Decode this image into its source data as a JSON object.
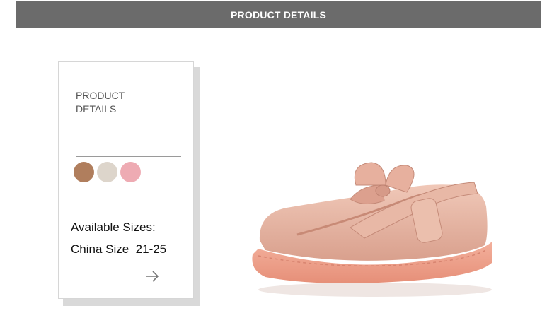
{
  "header": {
    "title": "PRODUCT DETAILS"
  },
  "card": {
    "title_line1": "PRODUCT",
    "title_line2": "DETAILS",
    "swatches": [
      {
        "name": "brown",
        "color": "#b07e5d"
      },
      {
        "name": "beige",
        "color": "#ddd5cb"
      },
      {
        "name": "pink",
        "color": "#eeabb3"
      }
    ],
    "sizes_label": "Available Sizes:",
    "sizes_value": "China Size  21-25",
    "arrow_icon": "arrow-right-icon"
  },
  "product": {
    "image_icon": "pink-mary-jane-shoe-with-bow"
  },
  "colors": {
    "header_bg": "#6b6b6b",
    "shoe": "#e2b3a2",
    "sole": "#ec9b86"
  }
}
